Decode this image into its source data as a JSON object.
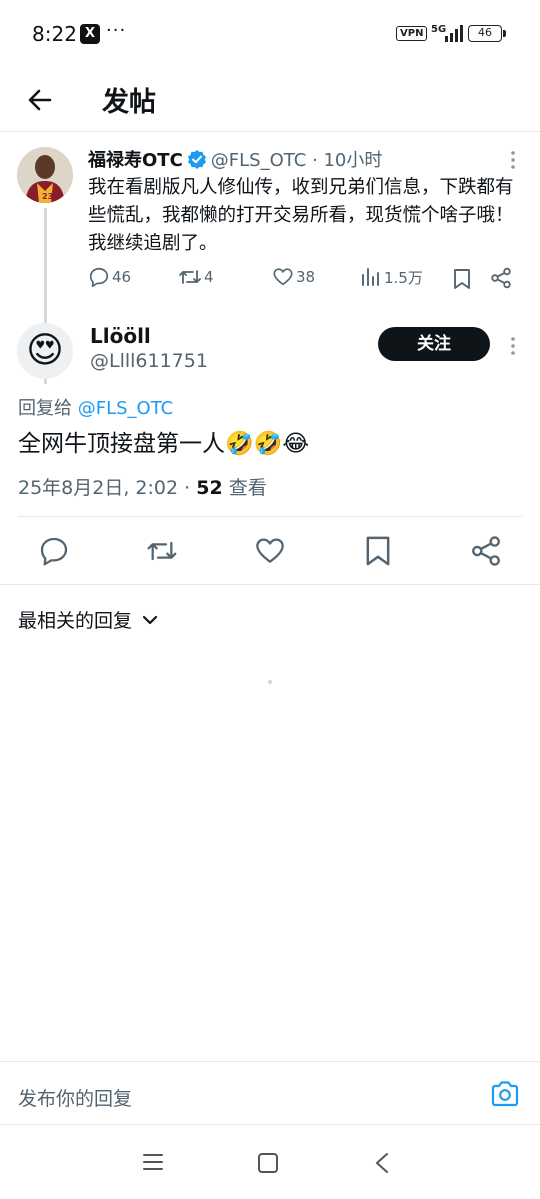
{
  "status": {
    "time": "8:22",
    "app_icon": "X",
    "more": "···",
    "vpn": "VPN",
    "network": "5G",
    "battery": "46"
  },
  "header": {
    "title": "发帖"
  },
  "parent_tweet": {
    "name": "福禄寿OTC",
    "handle": "@FLS_OTC",
    "time": "· 10小时",
    "text": "我在看剧版凡人修仙传，收到兄弟们信息，下跌都有些慌乱，我都懒的打开交易所看，现货慌个啥子哦！我继续追剧了。",
    "replies": "46",
    "retweets": "4",
    "likes": "38",
    "views": "1.5万"
  },
  "tweet": {
    "avatar_emoji": "😍",
    "name": "Llööll",
    "handle": "@Llll611751",
    "follow_label": "关注",
    "reply_prefix": "回复给 ",
    "reply_mention": "@FLS_OTC",
    "text": "全网牛顶接盘第一人",
    "emojis": "🤣🤣😂",
    "date": "25年8月2日, 2:02 · ",
    "view_count": "52",
    "view_label": " 查看"
  },
  "replies_sort": {
    "label": "最相关的回复"
  },
  "composer": {
    "placeholder": "发布你的回复"
  },
  "colors": {
    "accent": "#1d9bf0",
    "text": "#0f1419",
    "secondary": "#536471",
    "border": "#e6e8eb"
  }
}
